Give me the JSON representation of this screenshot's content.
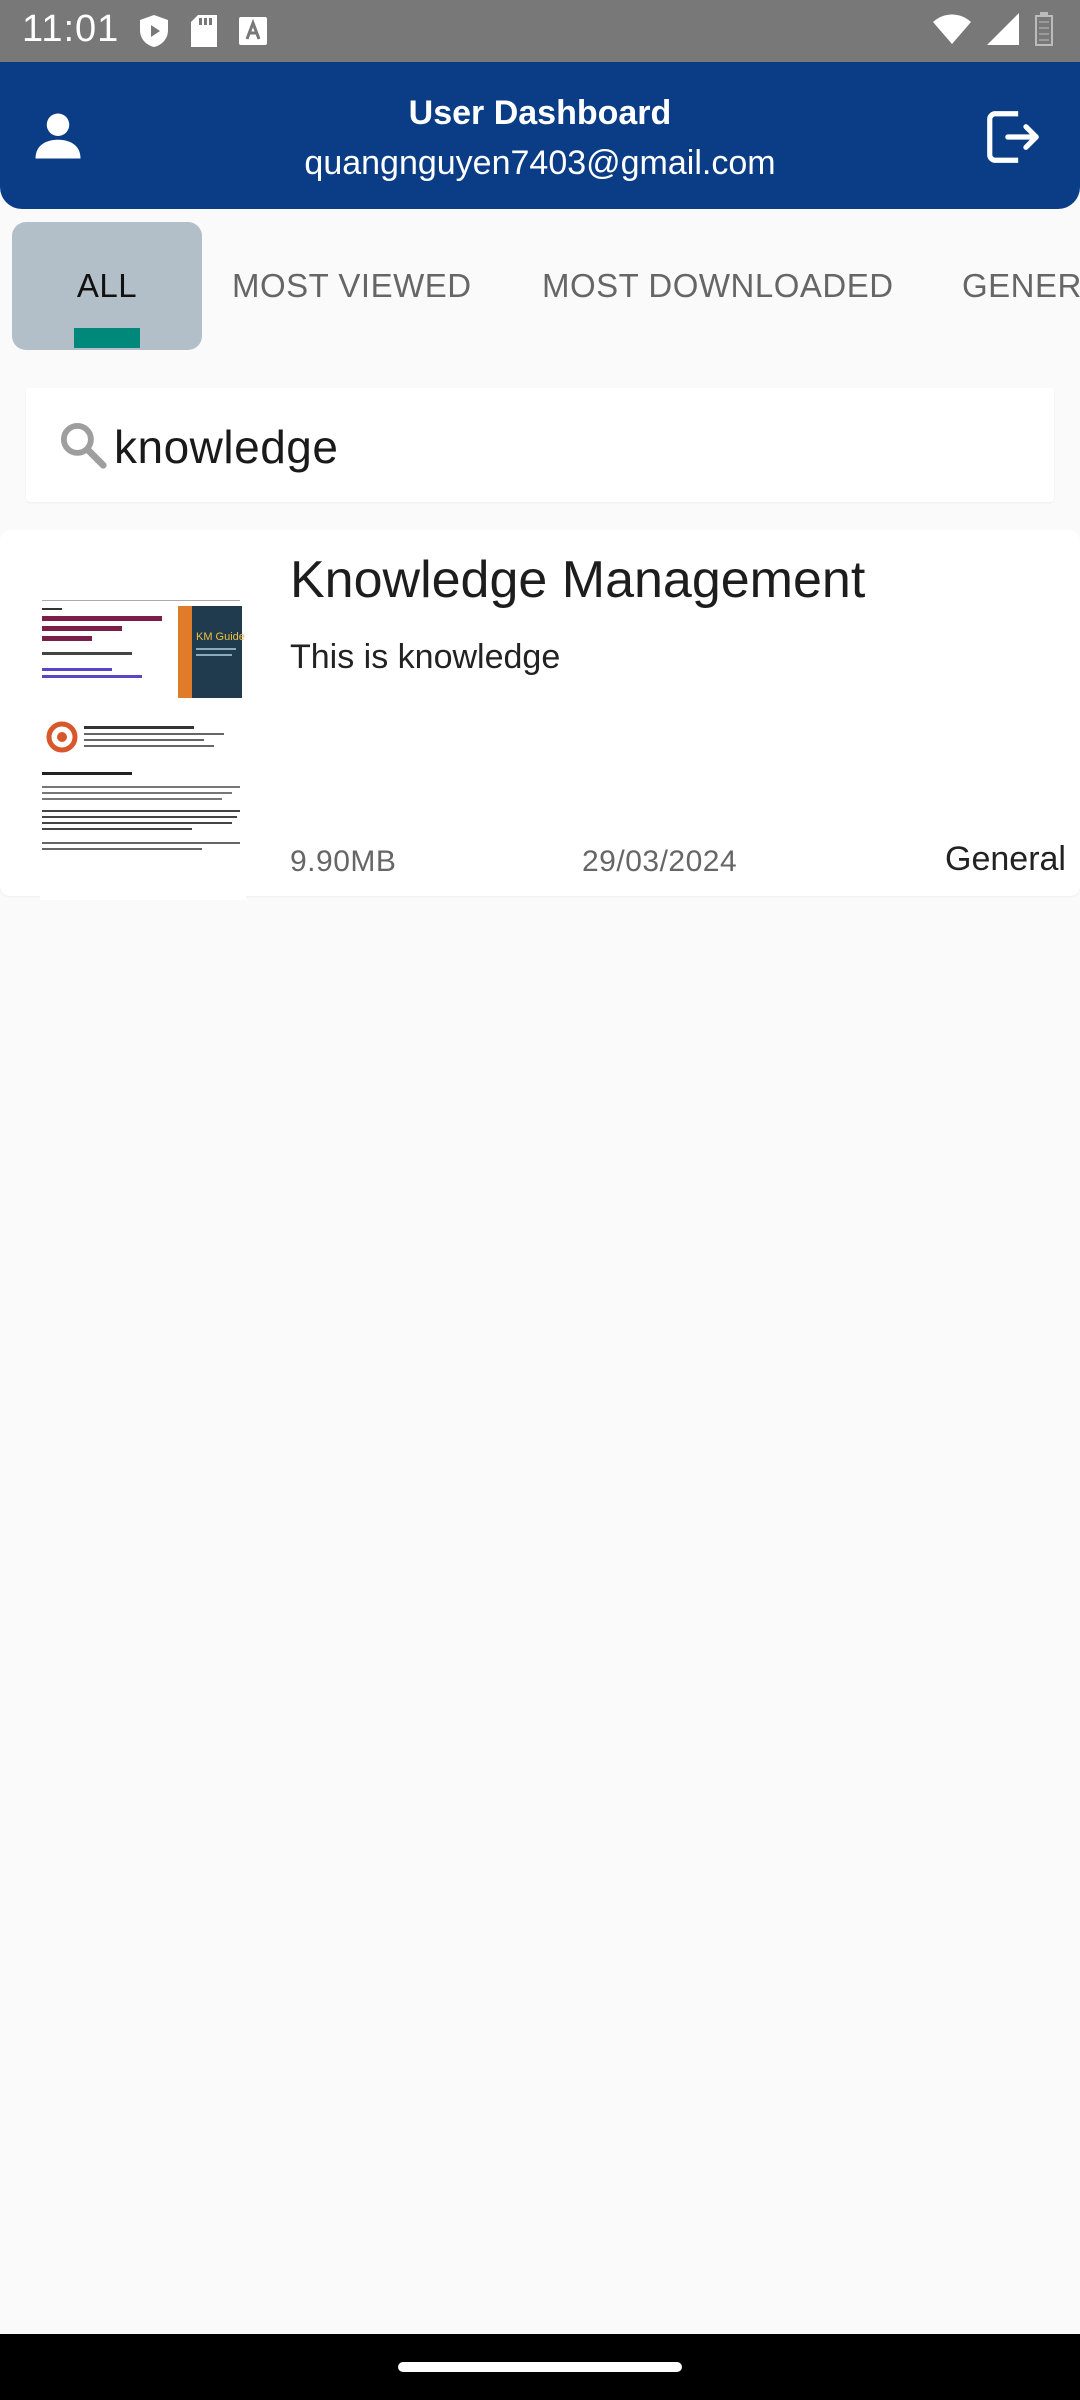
{
  "status_bar": {
    "time": "11:01",
    "icons_left": [
      "shield-icon",
      "sd-card-icon",
      "font-icon"
    ],
    "icons_right": [
      "wifi-icon",
      "signal-icon",
      "battery-icon"
    ]
  },
  "app_bar": {
    "title": "User Dashboard",
    "email": "quangnguyen7403@gmail.com",
    "left_icon": "user-icon",
    "right_icon": "logout-icon",
    "background": "#0a3d85"
  },
  "tabs": [
    {
      "label": "ALL",
      "selected": true
    },
    {
      "label": "MOST VIEWED",
      "selected": false
    },
    {
      "label": "MOST DOWNLOADED",
      "selected": false
    },
    {
      "label": "GENER",
      "selected": false
    }
  ],
  "tab_indicator_color": "#00897b",
  "search": {
    "value": "knowledge",
    "icon": "search-icon"
  },
  "documents": [
    {
      "title": "Knowledge Management",
      "description": "This is knowledge",
      "size": "9.90MB",
      "date": "29/03/2024",
      "category": "General",
      "thumbnail": {
        "heading": "Practical Knowledge Management Guide for SME Owners and Managers",
        "cover_text": "KM Guide"
      }
    }
  ]
}
